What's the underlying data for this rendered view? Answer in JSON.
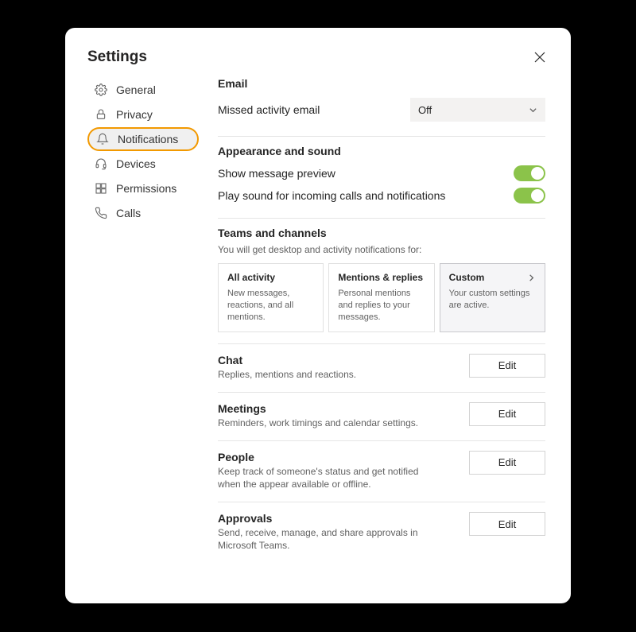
{
  "header": {
    "title": "Settings"
  },
  "sidebar": {
    "items": [
      {
        "label": "General"
      },
      {
        "label": "Privacy"
      },
      {
        "label": "Notifications"
      },
      {
        "label": "Devices"
      },
      {
        "label": "Permissions"
      },
      {
        "label": "Calls"
      }
    ]
  },
  "email": {
    "title": "Email",
    "row_label": "Missed activity email",
    "value": "Off"
  },
  "appearance": {
    "title": "Appearance and sound",
    "preview_label": "Show message preview",
    "sound_label": "Play sound for incoming calls and notifications"
  },
  "teams": {
    "title": "Teams and channels",
    "desc": "You will get desktop and activity notifications for:",
    "cards": [
      {
        "title": "All activity",
        "desc": "New messages, reactions, and all mentions."
      },
      {
        "title": "Mentions & replies",
        "desc": "Personal mentions and replies to your messages."
      },
      {
        "title": "Custom",
        "desc": "Your custom settings are active."
      }
    ]
  },
  "sections": [
    {
      "title": "Chat",
      "desc": "Replies, mentions and reactions.",
      "button": "Edit"
    },
    {
      "title": "Meetings",
      "desc": "Reminders, work timings and calendar settings.",
      "button": "Edit"
    },
    {
      "title": "People",
      "desc": "Keep track of someone's status and get notified when the appear available or offline.",
      "button": "Edit"
    },
    {
      "title": "Approvals",
      "desc": "Send, receive, manage, and share approvals in Microsoft Teams.",
      "button": "Edit"
    }
  ]
}
